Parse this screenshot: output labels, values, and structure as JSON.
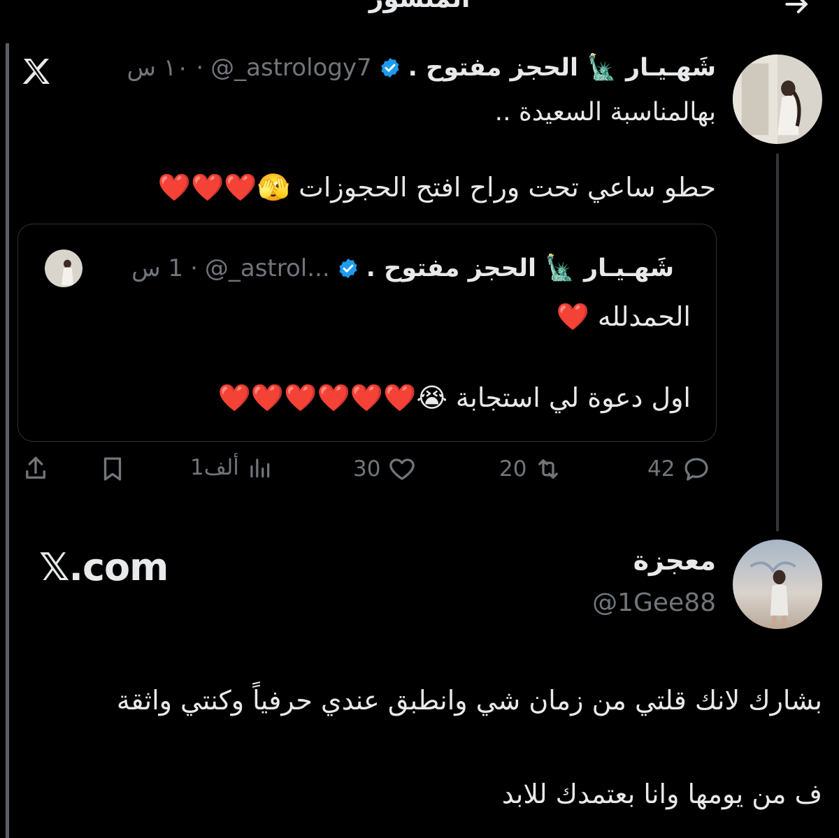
{
  "header": {
    "title": "المنشور",
    "back_icon": "arrow-right-icon"
  },
  "tweet": {
    "name": "شَهـيـار 🗽 الحجز مفتوح .",
    "handle": "@_astrology7",
    "time": "١٠ س",
    "line1": "بهالمناسبة السعيدة ..",
    "line2": "حطو ساعي تحت وراح افتح الحجوزات 🫣❤️❤️❤️",
    "quote": {
      "name": "شَهـيـار 🗽 الحجز مفتوح .",
      "handle": "@_astrol...",
      "time": "1 س",
      "line1": "الحمدلله ❤️",
      "line2": "اول دعوة لي استجابة 😭❤️❤️❤️❤️❤️❤️"
    },
    "actions": {
      "replies": "42",
      "retweets": "20",
      "likes": "30",
      "views": "1ألف"
    }
  },
  "reply": {
    "name": "معجزة",
    "handle": "@1Gee88",
    "watermark": "𝕏.com",
    "line1": "بشارك لانك قلتي من زمان شي وانطبق عندي حرفياً وكنتي واثقة",
    "line2": "ف من يومها وانا بعتمدك للابد"
  },
  "colors": {
    "background": "#000000",
    "text": "#e7e9ea",
    "muted": "#71767b",
    "verified": "#1d9bf0",
    "heart": "#e0202c"
  }
}
